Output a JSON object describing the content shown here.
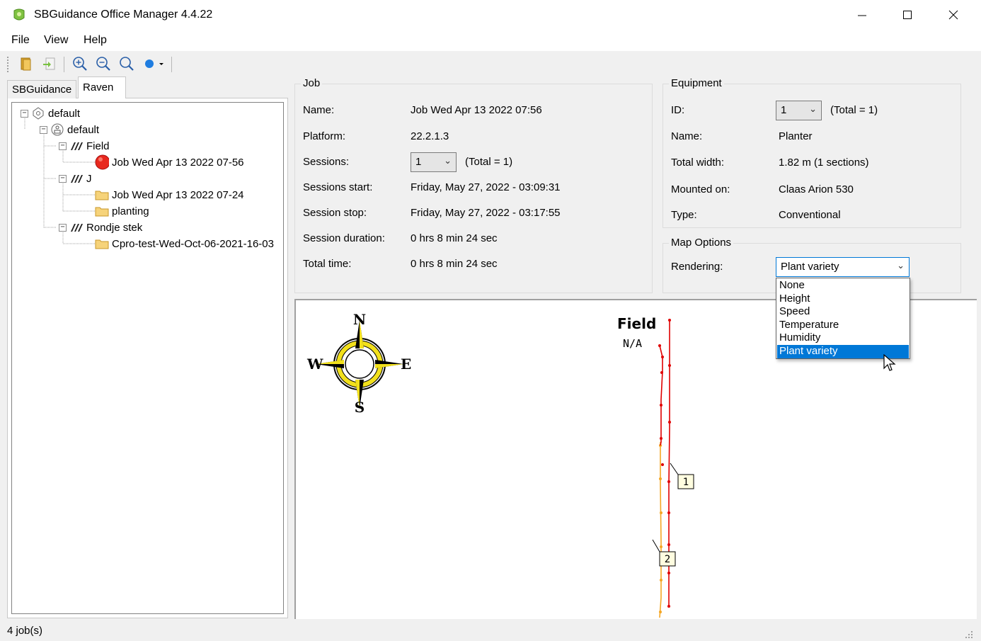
{
  "window": {
    "title": "SBGuidance Office Manager 4.4.22"
  },
  "menu": [
    "File",
    "View",
    "Help"
  ],
  "toolbar": {
    "buttons": [
      "open-folder-icon",
      "import-icon",
      "zoom-in-icon",
      "zoom-out-icon",
      "zoom-fit-icon",
      "color-dot-dropdown-icon"
    ]
  },
  "tabs": [
    {
      "label": "SBGuidance",
      "active": false
    },
    {
      "label": "Raven",
      "active": true
    }
  ],
  "tree": [
    {
      "label": "default",
      "level": 0,
      "icon": "cloud-node-icon",
      "expander": "−"
    },
    {
      "label": "default",
      "level": 1,
      "icon": "farm-node-icon",
      "expander": "−"
    },
    {
      "label": "Field",
      "level": 2,
      "icon": "field-icon",
      "expander": "−"
    },
    {
      "label": "Job Wed Apr 13 2022 07-56",
      "level": 3,
      "icon": "red-job-icon",
      "expander": ""
    },
    {
      "label": "J",
      "level": 2,
      "icon": "field-icon",
      "expander": "−"
    },
    {
      "label": "Job Wed Apr 13 2022 07-24",
      "level": 3,
      "icon": "folder-icon",
      "expander": ""
    },
    {
      "label": "planting",
      "level": 3,
      "icon": "folder-icon",
      "expander": ""
    },
    {
      "label": "Rondje stek",
      "level": 2,
      "icon": "field-icon",
      "expander": "−"
    },
    {
      "label": "Cpro-test-Wed-Oct-06-2021-16-03",
      "level": 3,
      "icon": "folder-icon",
      "expander": ""
    }
  ],
  "job": {
    "title": "Job",
    "name_label": "Name:",
    "name": "Job Wed Apr 13 2022 07:56",
    "platform_label": "Platform:",
    "platform": "22.2.1.3",
    "sessions_label": "Sessions:",
    "sessions_value": "1",
    "sessions_total": "(Total = 1)",
    "start_label": "Sessions start:",
    "start": "Friday, May 27, 2022 - 03:09:31",
    "stop_label": "Session stop:",
    "stop": "Friday, May 27, 2022 - 03:17:55",
    "duration_label": "Session duration:",
    "duration": "0 hrs 8 min 24 sec",
    "total_label": "Total time:",
    "total": "0 hrs 8 min 24 sec"
  },
  "equipment": {
    "title": "Equipment",
    "id_label": "ID:",
    "id_value": "1",
    "id_total": "(Total = 1)",
    "name_label": "Name:",
    "name": "Planter",
    "width_label": "Total width:",
    "width": "1.82 m (1 sections)",
    "mounted_label": "Mounted on:",
    "mounted": "Claas Arion 530",
    "type_label": "Type:",
    "type": "Conventional"
  },
  "map_options": {
    "title": "Map Options",
    "rendering_label": "Rendering:",
    "rendering_value": "Plant variety",
    "options": [
      "None",
      "Height",
      "Speed",
      "Temperature",
      "Humidity",
      "Plant variety"
    ],
    "selected_index": 5
  },
  "map": {
    "compass": {
      "n": "N",
      "e": "E",
      "s": "S",
      "w": "W"
    },
    "field_title": "Field",
    "field_subtitle": "N/A",
    "markers": [
      "1",
      "2"
    ],
    "colors": {
      "pass1": "#e00000",
      "pass2": "#f5a623"
    }
  },
  "status": {
    "text": "4 job(s)"
  }
}
